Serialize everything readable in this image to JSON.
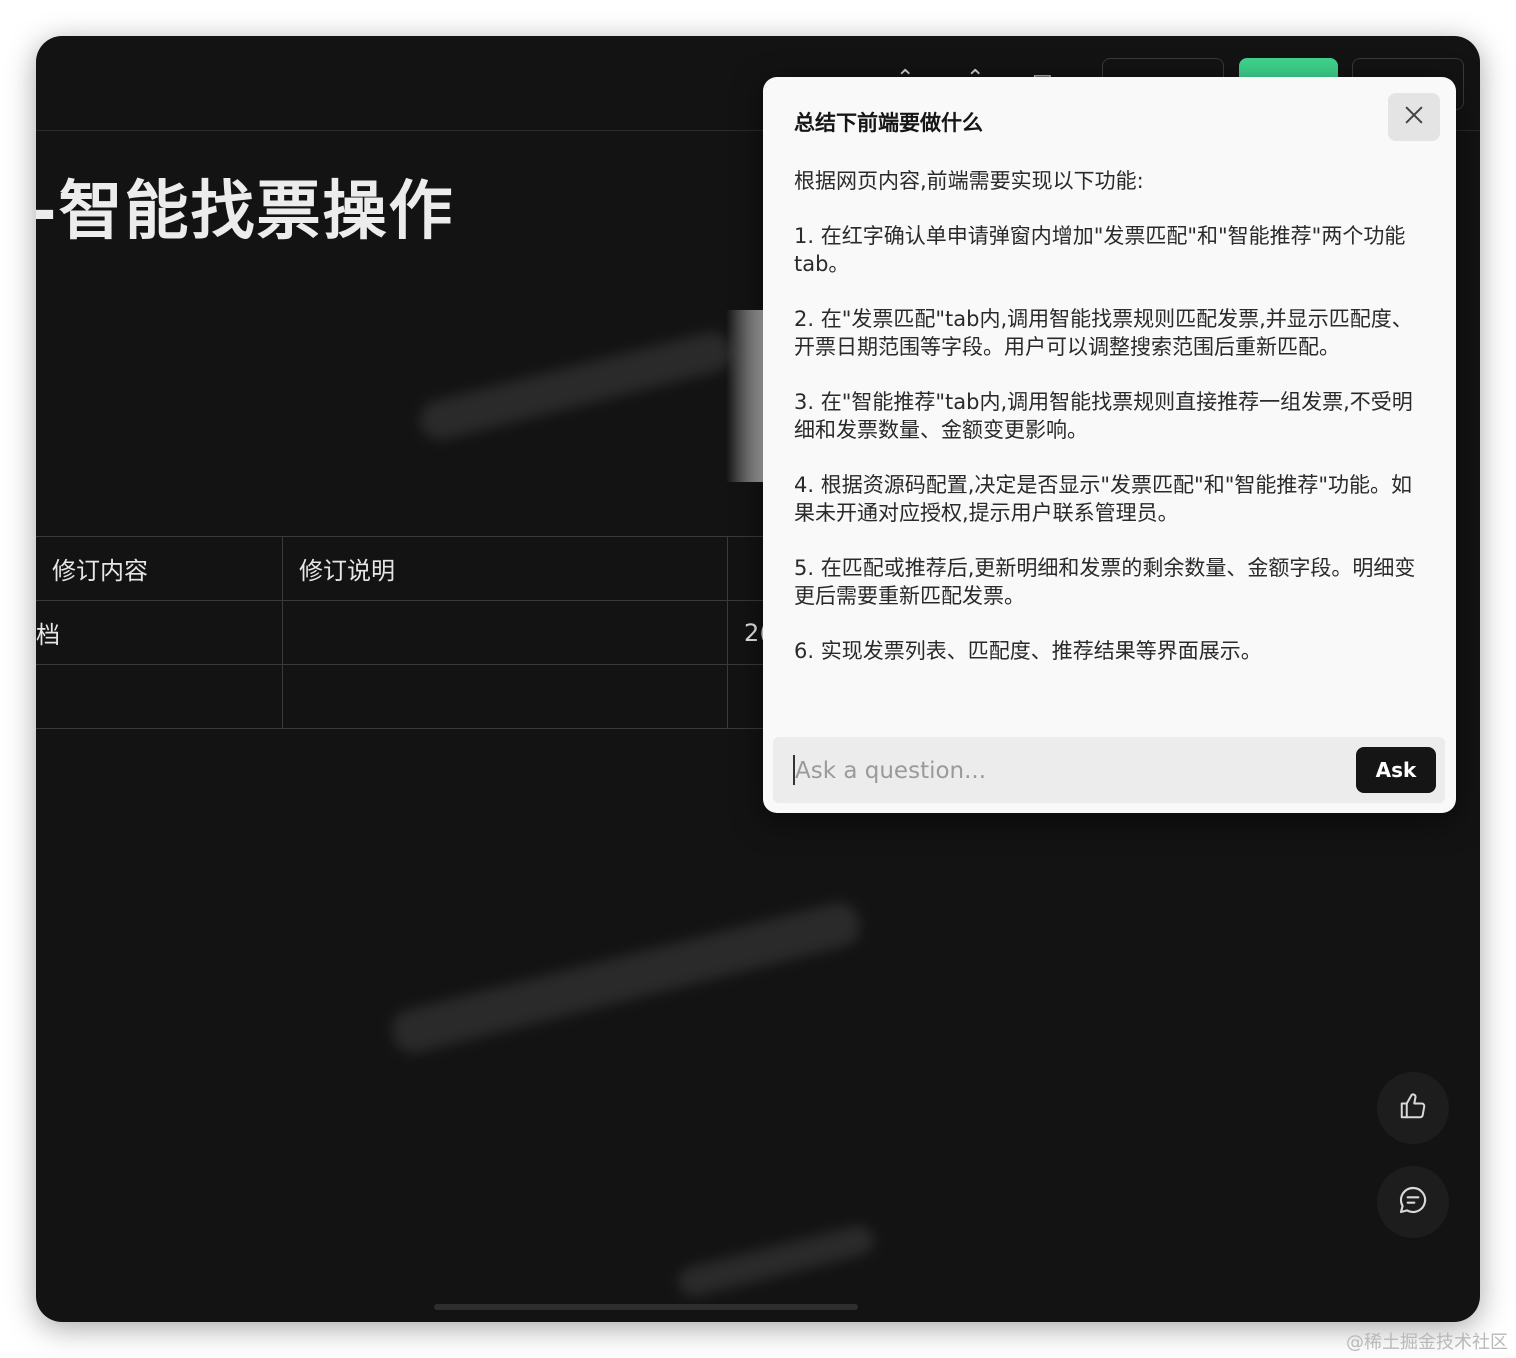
{
  "document": {
    "title": "-智能找票操作",
    "table_headers": [
      "修订内容",
      "修订说明"
    ],
    "row1_partial_first": "档",
    "row1_partial_third": "2("
  },
  "popup": {
    "question": "总结下前端要做什么",
    "answer_paragraphs": [
      "根据网页内容,前端需要实现以下功能:",
      "1. 在红字确认单申请弹窗内增加\"发票匹配\"和\"智能推荐\"两个功能tab。",
      "2. 在\"发票匹配\"tab内,调用智能找票规则匹配发票,并显示匹配度、开票日期范围等字段。用户可以调整搜索范围后重新匹配。",
      "3. 在\"智能推荐\"tab内,调用智能找票规则直接推荐一组发票,不受明细和发票数量、金额变更影响。",
      "4. 根据资源码配置,决定是否显示\"发票匹配\"和\"智能推荐\"功能。如果未开通对应授权,提示用户联系管理员。",
      "5. 在匹配或推荐后,更新明细和发票的剩余数量、金额字段。明细变更后需要重新匹配发票。",
      "6. 实现发票列表、匹配度、推荐结果等界面展示。"
    ],
    "input_placeholder": "Ask a question...",
    "ask_label": "Ask"
  },
  "icons": {
    "close": "close-icon",
    "thumbs_up": "thumbs-up-icon",
    "comment": "comment-icon"
  },
  "colors": {
    "background": "#131313",
    "popup": "#f9f9f9",
    "accent_green": "#3fd38c",
    "ask_button": "#151515"
  },
  "watermark": "@稀土掘金技术社区"
}
